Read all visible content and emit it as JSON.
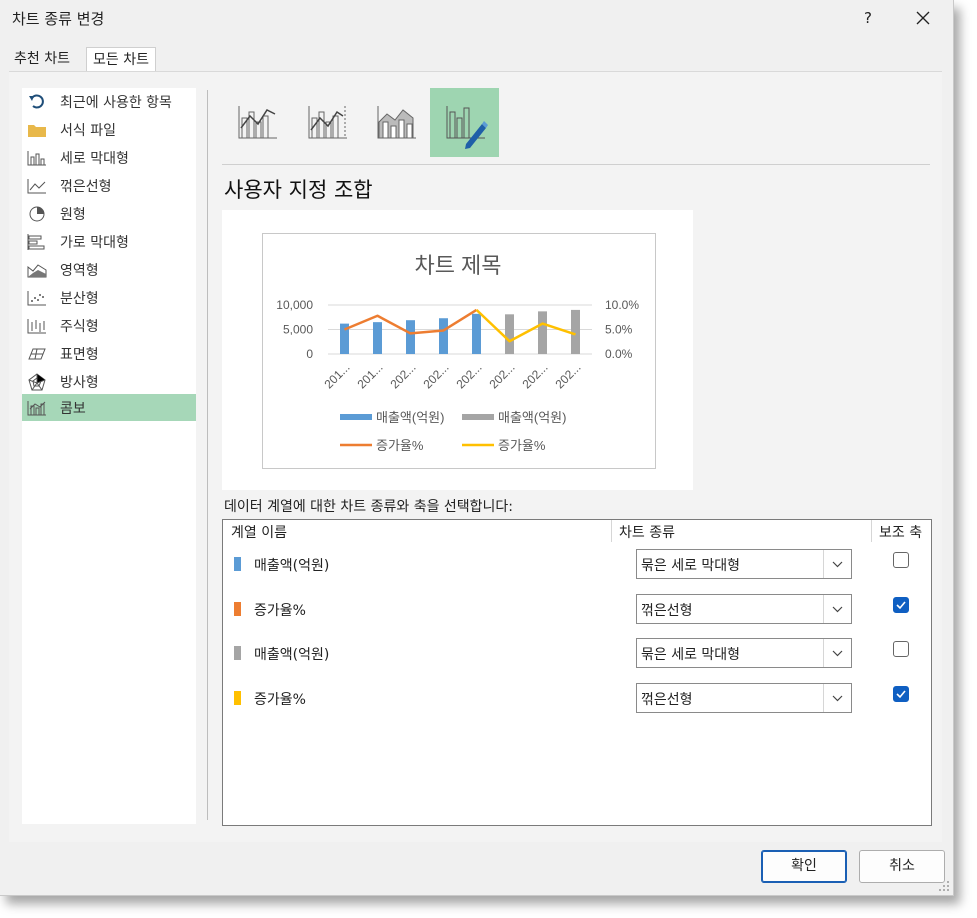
{
  "window": {
    "title": "차트 종류 변경",
    "help_label": "?"
  },
  "tabs": [
    "추천 차트",
    "모든 차트"
  ],
  "sidebar": {
    "items": [
      {
        "label": "최근에 사용한 항목",
        "icon": "recent-icon"
      },
      {
        "label": "서식 파일",
        "icon": "folder-icon"
      },
      {
        "label": "세로 막대형",
        "icon": "column-chart-icon"
      },
      {
        "label": "꺾은선형",
        "icon": "line-chart-icon"
      },
      {
        "label": "원형",
        "icon": "pie-chart-icon"
      },
      {
        "label": "가로 막대형",
        "icon": "bar-chart-icon"
      },
      {
        "label": "영역형",
        "icon": "area-chart-icon"
      },
      {
        "label": "분산형",
        "icon": "scatter-chart-icon"
      },
      {
        "label": "주식형",
        "icon": "stock-chart-icon"
      },
      {
        "label": "표면형",
        "icon": "surface-chart-icon"
      },
      {
        "label": "방사형",
        "icon": "radar-chart-icon"
      },
      {
        "label": "콤보",
        "icon": "combo-chart-icon"
      }
    ],
    "selected": "콤보"
  },
  "subtype": {
    "title": "사용자 지정 조합"
  },
  "chart_data": {
    "type": "bar",
    "title": "차트 제목",
    "categories": [
      "201...",
      "201...",
      "202...",
      "202...",
      "202...",
      "202...",
      "202...",
      "202..."
    ],
    "ylim_primary": [
      0,
      10000
    ],
    "ylim_secondary": [
      0,
      0.1
    ],
    "primary_ticks": [
      "10,000",
      "5,000",
      "0"
    ],
    "secondary_ticks": [
      "10.0%",
      "5.0%",
      "0.0%"
    ],
    "series": [
      {
        "name": "매출액(억원)",
        "type": "bar",
        "axis": "primary",
        "color": "#5b9bd5",
        "values": [
          6200,
          6500,
          6900,
          7300,
          8200,
          null,
          null,
          null
        ]
      },
      {
        "name": "매출액(억원)",
        "type": "bar",
        "axis": "primary",
        "color": "#a5a5a5",
        "values": [
          null,
          null,
          null,
          null,
          null,
          8100,
          8700,
          9000
        ]
      },
      {
        "name": "증가율%",
        "type": "line",
        "axis": "secondary",
        "color": "#ed7d31",
        "values": [
          0.05,
          0.078,
          0.042,
          0.048,
          0.09,
          null,
          null,
          null
        ]
      },
      {
        "name": "증가율%",
        "type": "line",
        "axis": "secondary",
        "color": "#ffc000",
        "values": [
          null,
          null,
          null,
          null,
          0.09,
          0.026,
          0.062,
          0.04
        ]
      }
    ],
    "legend": "bottom"
  },
  "series_table": {
    "instruction": "데이터 계열에 대한 차트 종류와 축을 선택합니다:",
    "headers": {
      "name": "계열 이름",
      "type": "차트 종류",
      "secondary": "보조 축"
    },
    "rows": [
      {
        "name": "매출액(억원)",
        "chart_type": "묶은 세로 막대형",
        "secondary": false,
        "color": "#5b9bd5"
      },
      {
        "name": "증가율%",
        "chart_type": "꺾은선형",
        "secondary": true,
        "color": "#ed7d31"
      },
      {
        "name": "매출액(억원)",
        "chart_type": "묶은 세로 막대형",
        "secondary": false,
        "color": "#a5a5a5"
      },
      {
        "name": "증가율%",
        "chart_type": "꺾은선형",
        "secondary": true,
        "color": "#ffc000"
      }
    ]
  },
  "buttons": {
    "ok": "확인",
    "cancel": "취소"
  },
  "colors": {
    "accent_green": "#a6d7b8",
    "checkbox_blue": "#0f5fc2"
  }
}
